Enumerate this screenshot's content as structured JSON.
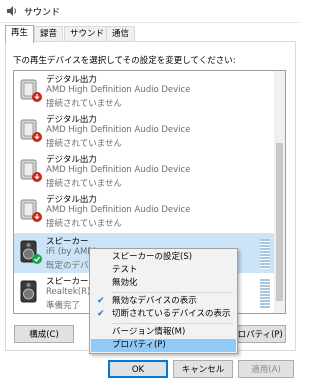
{
  "window": {
    "title": "サウンド"
  },
  "tabs": [
    "再生",
    "録音",
    "サウンド",
    "通信"
  ],
  "instruction": "下の再生デバイスを選択してその設定を変更してください:",
  "devices": [
    {
      "name": "デジタル出力",
      "driver": "AMD High Definition Audio Device",
      "status": "接続されていません"
    },
    {
      "name": "デジタル出力",
      "driver": "AMD High Definition Audio Device",
      "status": "接続されていません"
    },
    {
      "name": "デジタル出力",
      "driver": "AMD High Definition Audio Device",
      "status": "接続されていません"
    },
    {
      "name": "デジタル出力",
      "driver": "AMD High Definition Audio Device",
      "status": "接続されていません"
    },
    {
      "name": "スピーカー",
      "driver": "iFi (by AMR)",
      "status": "既定のデバイス"
    },
    {
      "name": "スピーカー",
      "driver": "Realtek(R) Au",
      "status": "準備完了"
    }
  ],
  "context_menu": {
    "items": [
      {
        "label": "スピーカーの設定(S)",
        "checked": false
      },
      {
        "label": "テスト",
        "checked": false
      },
      {
        "label": "無効化",
        "checked": false
      },
      {
        "label": "無効なデバイスの表示",
        "checked": true
      },
      {
        "label": "切断されているデバイスの表示",
        "checked": true
      },
      {
        "label": "バージョン情報(M)",
        "checked": false
      },
      {
        "label": "プロパティ(P)",
        "checked": false,
        "highlighted": true
      }
    ]
  },
  "buttons": {
    "configure": "構成(C)",
    "properties": "プロパティ(P)",
    "ok": "OK",
    "cancel": "キャンセル",
    "apply": "適用(A)"
  },
  "colors": {
    "selection": "#cce4f7",
    "menu_highlight": "#91c9f7",
    "accent": "#0078d7",
    "error_badge": "#c42b1c",
    "ok_badge": "#16a34a"
  }
}
